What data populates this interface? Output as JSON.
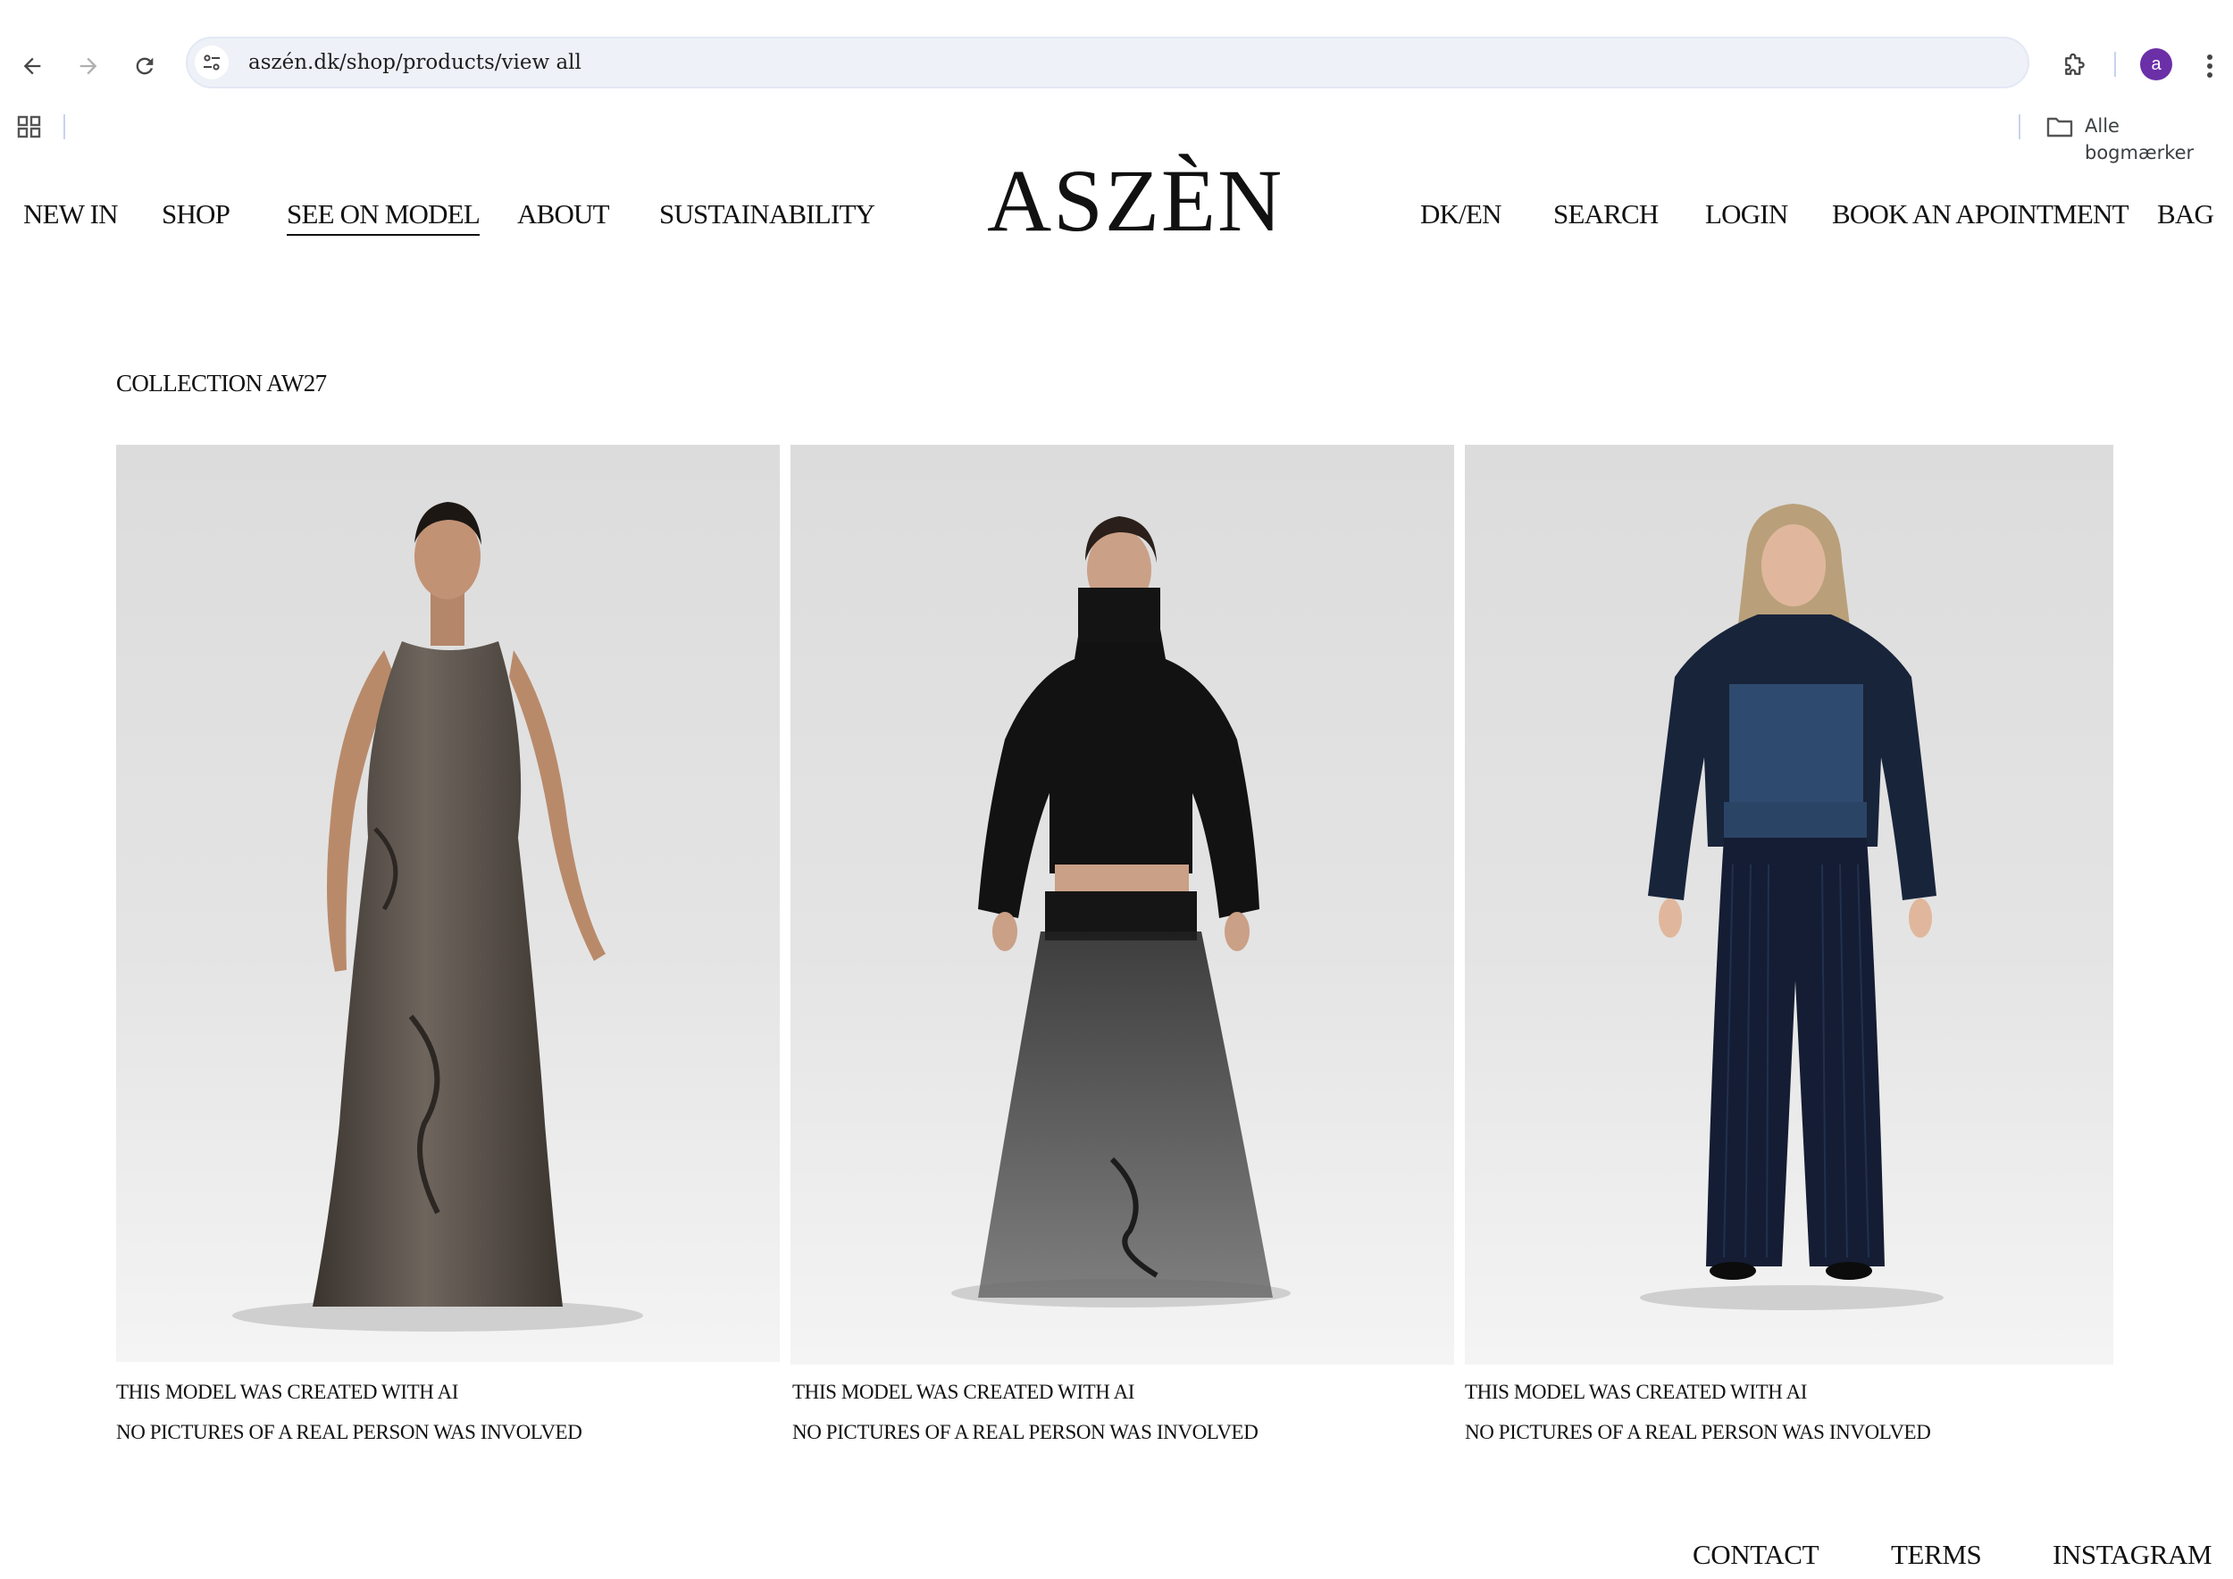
{
  "browser": {
    "url": "aszén.dk/shop/products/view all",
    "avatar_letter": "a",
    "bookmarks_folder": "Alle bogmærker"
  },
  "site": {
    "brand": "ASZÈN",
    "nav_left": [
      "NEW IN",
      "SHOP",
      "SEE ON MODEL",
      "ABOUT",
      "SUSTAINABILITY"
    ],
    "nav_right": [
      "DK/EN",
      "SEARCH",
      "LOGIN",
      "BOOK AN APOINTMENT",
      "BAG"
    ],
    "active_nav": "SEE ON MODEL"
  },
  "main": {
    "collection_title": "COLLECTION AW27",
    "products": [
      {
        "image": "model-brown-satin-dress",
        "note_line1": "THIS MODEL WAS CREATED WITH AI",
        "note_line2": "NO PICTURES OF A REAL PERSON WAS INVOLVED"
      },
      {
        "image": "model-black-top-sheer-skirt",
        "note_line1": "THIS MODEL WAS CREATED WITH AI",
        "note_line2": "NO PICTURES OF A REAL PERSON WAS INVOLVED"
      },
      {
        "image": "model-navy-knit-set",
        "note_line1": "THIS MODEL WAS CREATED WITH AI",
        "note_line2": "NO PICTURES OF A REAL PERSON WAS INVOLVED"
      }
    ]
  },
  "footer": {
    "links": [
      "CONTACT",
      "TERMS",
      "INSTAGRAM"
    ]
  },
  "colors": {
    "page_bg": "#ffffff",
    "text": "#111111",
    "address_bar": "#eef1f8",
    "avatar": "#6b2fa7",
    "photo_bg": "#dedede"
  }
}
